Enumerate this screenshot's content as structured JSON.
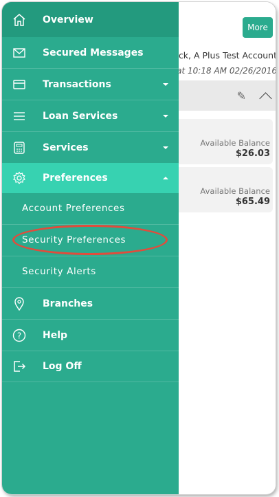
{
  "sidebar": {
    "items": [
      {
        "label": "Overview",
        "icon": "home-icon"
      },
      {
        "label": "Secured Messages",
        "icon": "envelope-icon"
      },
      {
        "label": "Transactions",
        "icon": "card-icon"
      },
      {
        "label": "Loan Services",
        "icon": "list-icon"
      },
      {
        "label": "Services",
        "icon": "calculator-icon"
      },
      {
        "label": "Preferences",
        "icon": "gear-icon"
      },
      {
        "label": "Branches",
        "icon": "location-pin-icon"
      },
      {
        "label": "Help",
        "icon": "question-icon"
      },
      {
        "label": "Log Off",
        "icon": "logout-icon"
      }
    ],
    "sub_items": [
      {
        "label": "Account Preferences"
      },
      {
        "label": "Security Preferences"
      },
      {
        "label": "Security Alerts"
      }
    ]
  },
  "content": {
    "more_label": "More",
    "account_title": "ck, A Plus Test Account",
    "account_date": "02/26/2016 at 10:18 AM",
    "cards": [
      {
        "label": "Available Balance",
        "value": "$26.03"
      },
      {
        "label": "Available Balance",
        "value": "$65.49"
      }
    ]
  },
  "colors": {
    "sidebar": "#2bab8e",
    "active_item": "#37d2b1",
    "annotation": "#e14c3c"
  }
}
